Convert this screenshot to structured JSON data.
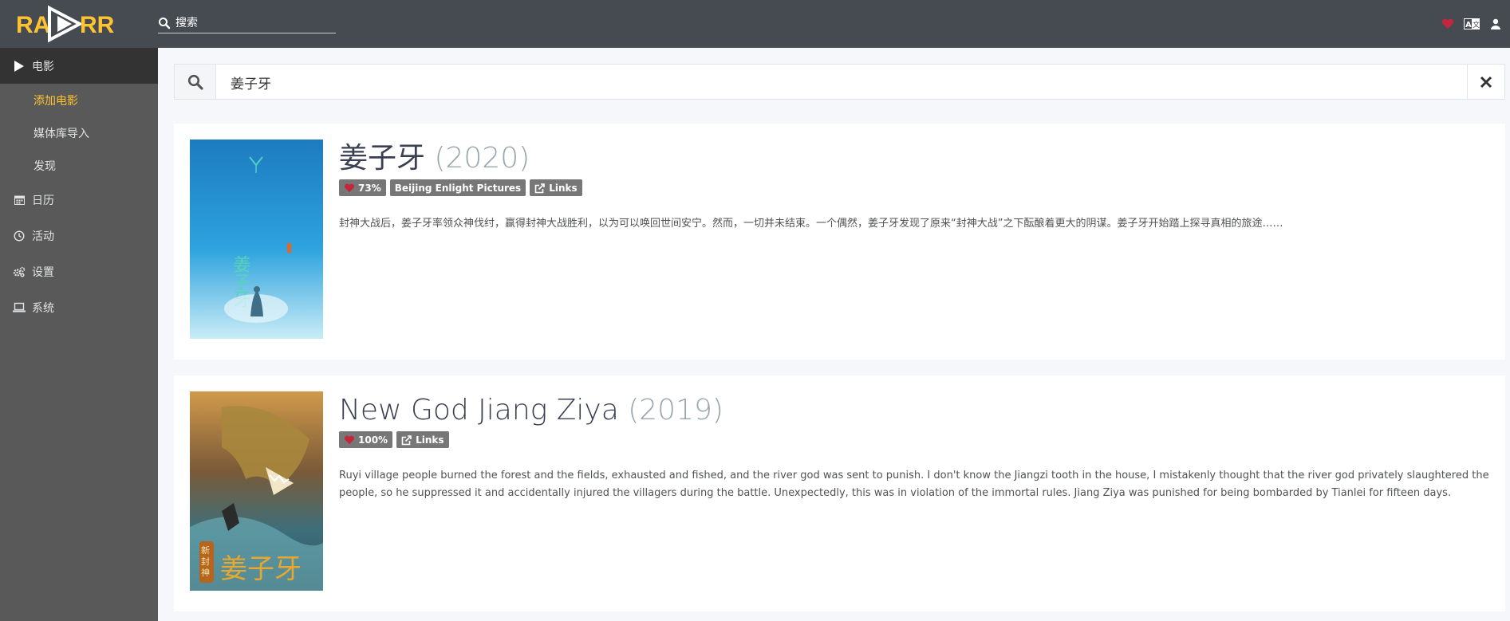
{
  "app": {
    "logo_text": "RADARR"
  },
  "header": {
    "search_placeholder": "搜索",
    "icons": [
      "heart-icon",
      "translate-icon",
      "user-icon"
    ]
  },
  "sidebar": {
    "items": [
      {
        "label": "电影",
        "icon": "play-icon",
        "active": true
      },
      {
        "label": "日历",
        "icon": "calendar-icon"
      },
      {
        "label": "活动",
        "icon": "clock-icon"
      },
      {
        "label": "设置",
        "icon": "cogs-icon"
      },
      {
        "label": "系统",
        "icon": "laptop-icon"
      }
    ],
    "subitems": [
      {
        "label": "添加电影",
        "active": true
      },
      {
        "label": "媒体库导入"
      },
      {
        "label": "发现"
      }
    ]
  },
  "search": {
    "value": "姜子牙"
  },
  "results": [
    {
      "title": "姜子牙",
      "year": "(2020)",
      "rating": "73%",
      "studio": "Beijing Enlight Pictures",
      "links_label": "Links",
      "overview": "封神大战后，姜子牙率领众神伐纣，赢得封神大战胜利，以为可以唤回世间安宁。然而，一切并未结束。一个偶然，姜子牙发现了原来“封神大战”之下酝酿着更大的阴谋。姜子牙开始踏上探寻真相的旅途……"
    },
    {
      "title": "New God Jiang Ziya",
      "year": "(2019)",
      "rating": "100%",
      "links_label": "Links",
      "overview": "Ruyi village people burned the forest and the fields, exhausted and fished, and the river god was sent to punish. I don't know the Jiangzi tooth in the house, I mistakenly thought that the river god privately slaughtered the people, so he suppressed it and accidentally injured the villagers during the battle. Unexpectedly, this was in violation of the immortal rules. Jiang Ziya was punished for being bombarded by Tianlei for fifteen days.",
      "poster_text": "姜子牙"
    }
  ],
  "colors": {
    "accent": "#ffc230",
    "header": "#464b51",
    "sidebar": "#595959",
    "heart": "#c4273c",
    "label": "#777777"
  }
}
